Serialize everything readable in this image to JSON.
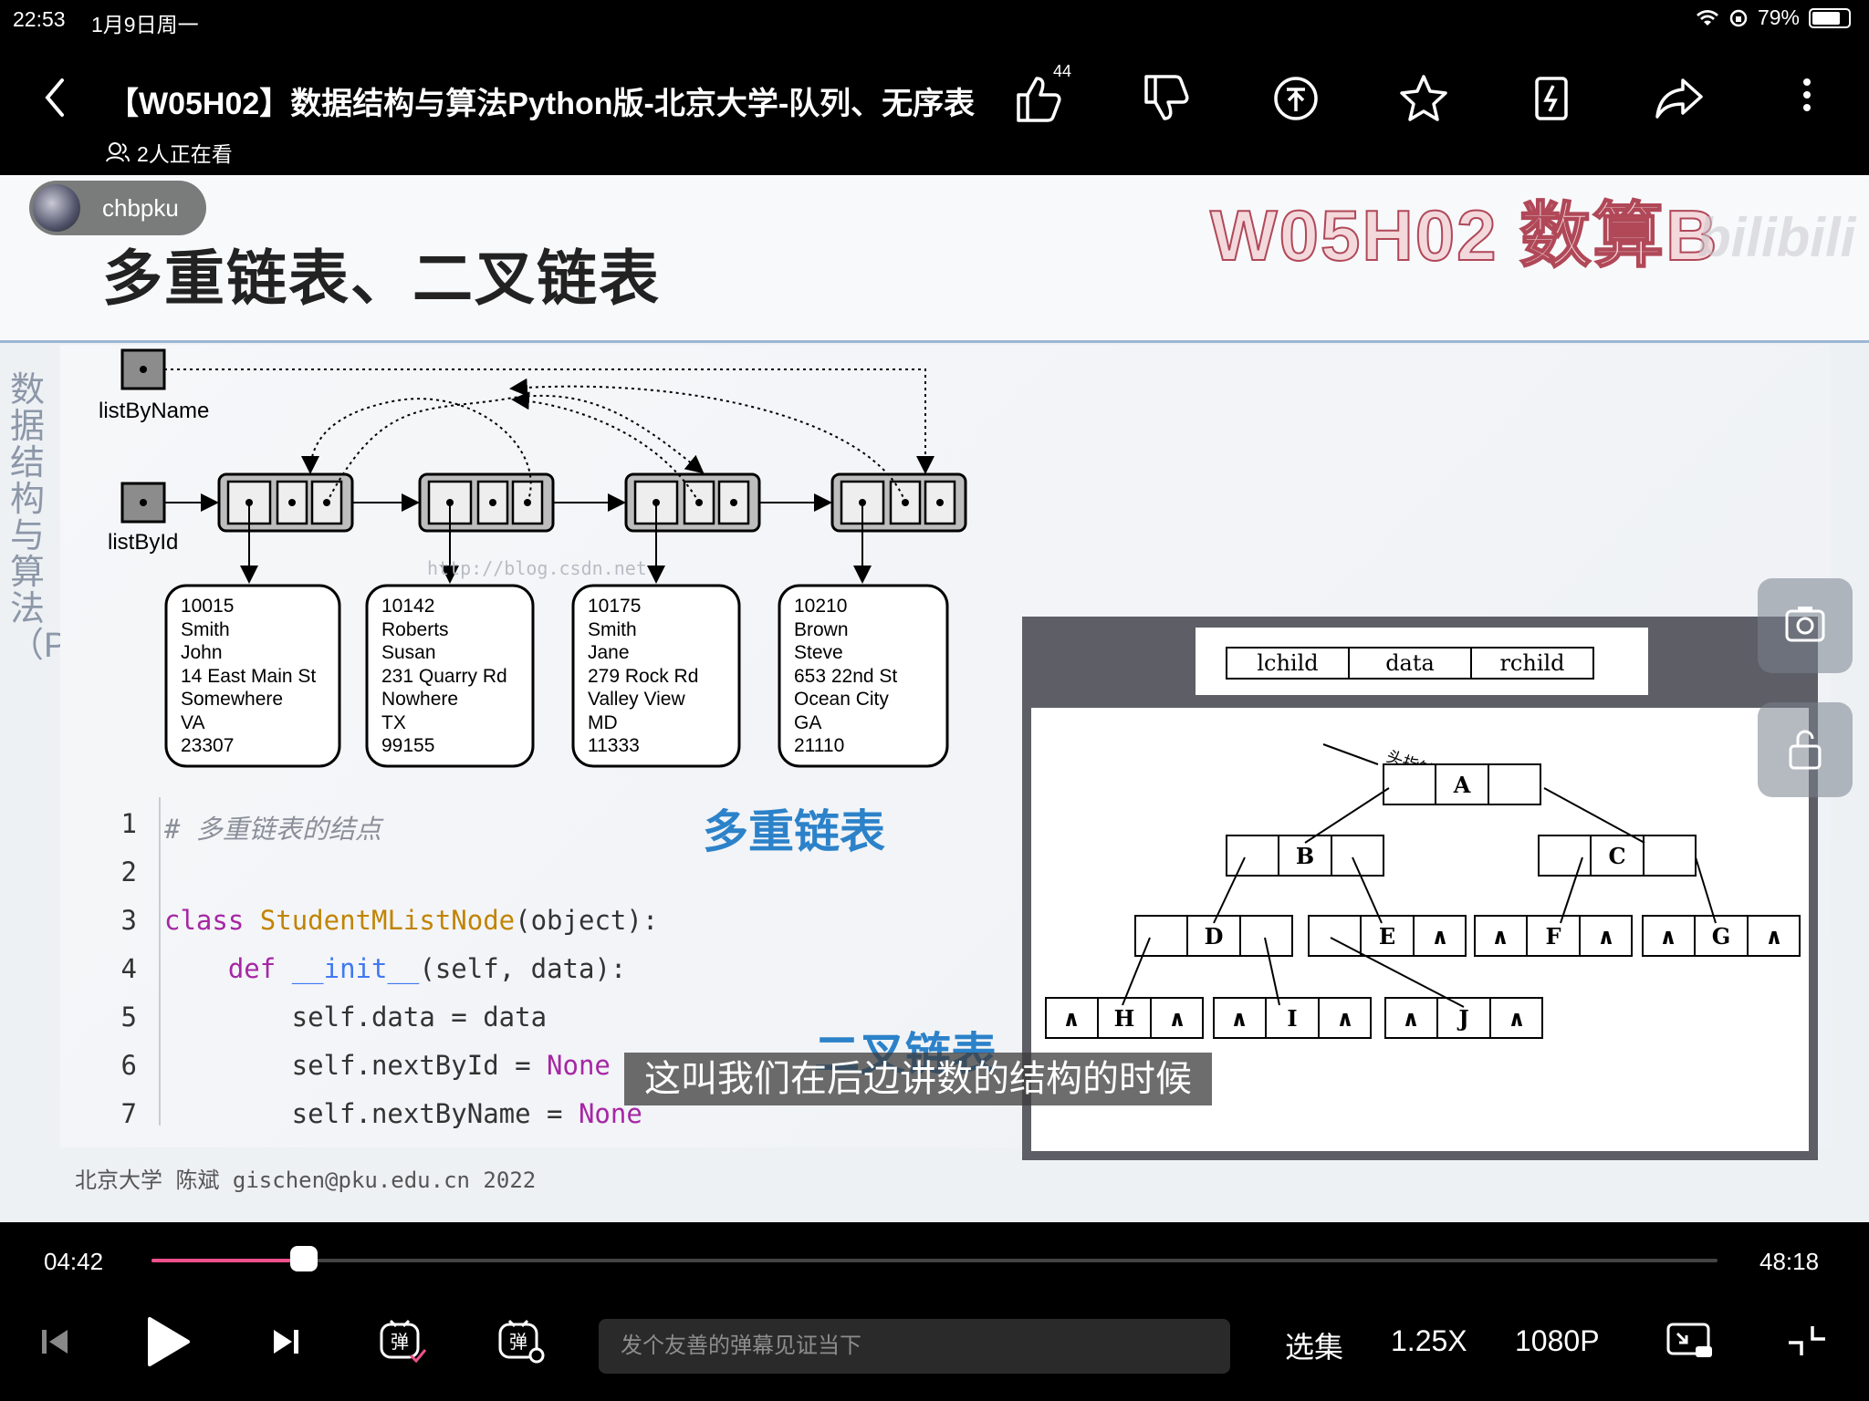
{
  "status": {
    "time": "22:53",
    "date": "1月9日周一",
    "battery": "79%"
  },
  "header": {
    "title": "【W05H02】数据结构与算法Python版-北京大学-队列、无序表",
    "like_count": "44",
    "watching": "2人正在看"
  },
  "video": {
    "uploader": "chbpku",
    "watermark": "W05H02 数算B",
    "watermark_brand": "bilibili",
    "slide_title": "多重链表、二叉链表",
    "side_title": "数据结构与算法（Python）",
    "pointers": {
      "by_name": "listByName",
      "by_id": "listById"
    },
    "records": [
      {
        "lines": [
          "10015",
          "Smith",
          "John",
          "14 East Main St",
          "Somewhere",
          "VA",
          "23307"
        ]
      },
      {
        "lines": [
          "10142",
          "Roberts",
          "Susan",
          "231 Quarry Rd",
          "Nowhere",
          "TX",
          "99155"
        ]
      },
      {
        "lines": [
          "10175",
          "Smith",
          "Jane",
          "279 Rock Rd",
          "Valley View",
          "MD",
          "11333"
        ]
      },
      {
        "lines": [
          "10210",
          "Brown",
          "Steve",
          "653 22nd St",
          "Ocean City",
          "GA",
          "21110"
        ]
      }
    ],
    "blog_watermark": "http://blog.csdn.net",
    "code": [
      {
        "n": "1",
        "text": "# 多重链表的结点"
      },
      {
        "n": "2",
        "text": ""
      },
      {
        "n": "3",
        "text": "class StudentMListNode(object):"
      },
      {
        "n": "4",
        "text": "    def __init__(self, data):"
      },
      {
        "n": "5",
        "text": "        self.data = data"
      },
      {
        "n": "6",
        "text": "        self.nextById = None"
      },
      {
        "n": "7",
        "text": "        self.nextByName = None"
      }
    ],
    "label_multilist": "多重链表",
    "label_bintree": "二叉链表",
    "footer": "北京大学 陈斌 gischen@pku.edu.cn 2022",
    "subtitle": "这叫我们在后边讲数的结构的时候",
    "tree": {
      "legend": [
        "lchild",
        "data",
        "rchild"
      ],
      "head_label": "头指针",
      "nodes": [
        "A",
        "B",
        "C",
        "D",
        "E",
        "F",
        "G",
        "H",
        "I",
        "J"
      ],
      "null_symbol": "∧"
    }
  },
  "controls": {
    "current_time": "04:42",
    "total_time": "48:18",
    "progress": 0.0975,
    "danmaku_placeholder": "发个友善的弹幕见证当下",
    "episodes": "选集",
    "speed": "1.25X",
    "quality": "1080P",
    "accent": "#f0508b"
  }
}
